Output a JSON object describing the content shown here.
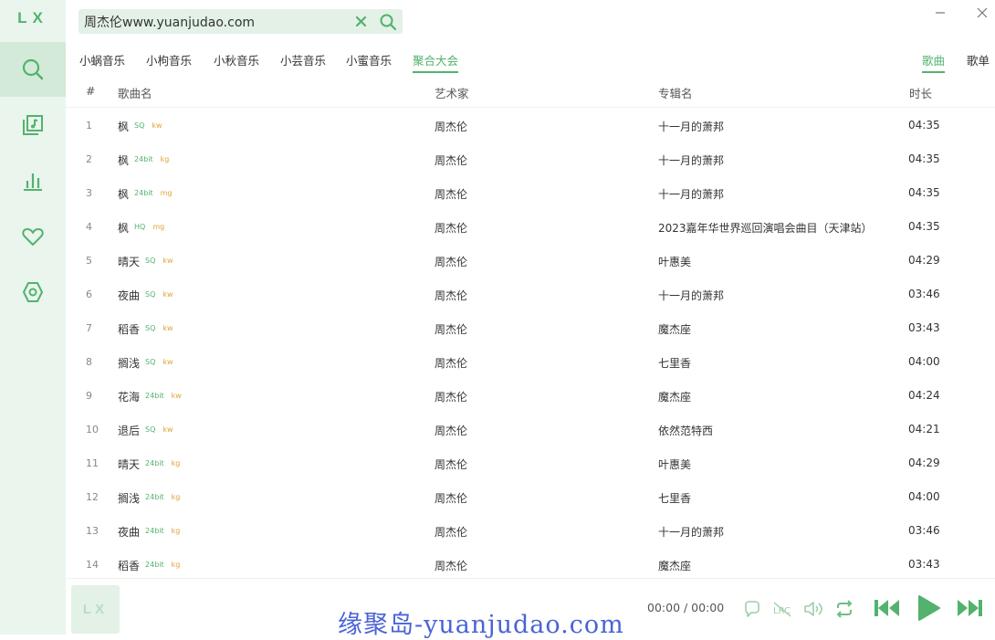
{
  "app": {
    "logo": "LX"
  },
  "sidebar": {
    "items": [
      {
        "name": "search",
        "active": true
      },
      {
        "name": "song-list"
      },
      {
        "name": "leaderboard"
      },
      {
        "name": "my-list"
      },
      {
        "name": "settings"
      }
    ]
  },
  "search": {
    "value": "周杰伦www.yuanjudao.com"
  },
  "sources": [
    "小蜗音乐",
    "小枸音乐",
    "小秋音乐",
    "小芸音乐",
    "小蜜音乐",
    "聚合大会"
  ],
  "active_source": "聚合大会",
  "search_type": {
    "song": "歌曲",
    "playlist": "歌单",
    "active": "歌曲"
  },
  "table": {
    "headers": {
      "num": "#",
      "name": "歌曲名",
      "artist": "艺术家",
      "album": "专辑名",
      "duration": "时长"
    },
    "rows": [
      {
        "num": "1",
        "name": "枫",
        "quality": "SQ",
        "source": "kw",
        "artist": "周杰伦",
        "album": "十一月的萧邦",
        "duration": "04:35"
      },
      {
        "num": "2",
        "name": "枫",
        "quality": "24bit",
        "source": "kg",
        "artist": "周杰伦",
        "album": "十一月的萧邦",
        "duration": "04:35"
      },
      {
        "num": "3",
        "name": "枫",
        "quality": "24bit",
        "source": "mg",
        "artist": "周杰伦",
        "album": "十一月的萧邦",
        "duration": "04:35"
      },
      {
        "num": "4",
        "name": "枫",
        "quality": "HQ",
        "source": "mg",
        "artist": "周杰伦",
        "album": "2023嘉年华世界巡回演唱会曲目（天津站）",
        "duration": "04:35"
      },
      {
        "num": "5",
        "name": "晴天",
        "quality": "SQ",
        "source": "kw",
        "artist": "周杰伦",
        "album": "叶惠美",
        "duration": "04:29"
      },
      {
        "num": "6",
        "name": "夜曲",
        "quality": "SQ",
        "source": "kw",
        "artist": "周杰伦",
        "album": "十一月的萧邦",
        "duration": "03:46"
      },
      {
        "num": "7",
        "name": "稻香",
        "quality": "SQ",
        "source": "kw",
        "artist": "周杰伦",
        "album": "魔杰座",
        "duration": "03:43"
      },
      {
        "num": "8",
        "name": "搁浅",
        "quality": "SQ",
        "source": "kw",
        "artist": "周杰伦",
        "album": "七里香",
        "duration": "04:00"
      },
      {
        "num": "9",
        "name": "花海",
        "quality": "24bit",
        "source": "kw",
        "artist": "周杰伦",
        "album": "魔杰座",
        "duration": "04:24"
      },
      {
        "num": "10",
        "name": "退后",
        "quality": "SQ",
        "source": "kw",
        "artist": "周杰伦",
        "album": "依然范特西",
        "duration": "04:21"
      },
      {
        "num": "11",
        "name": "晴天",
        "quality": "24bit",
        "source": "kg",
        "artist": "周杰伦",
        "album": "叶惠美",
        "duration": "04:29"
      },
      {
        "num": "12",
        "name": "搁浅",
        "quality": "24bit",
        "source": "kg",
        "artist": "周杰伦",
        "album": "七里香",
        "duration": "04:00"
      },
      {
        "num": "13",
        "name": "夜曲",
        "quality": "24bit",
        "source": "kg",
        "artist": "周杰伦",
        "album": "十一月的萧邦",
        "duration": "03:46"
      },
      {
        "num": "14",
        "name": "稻香",
        "quality": "24bit",
        "source": "kg",
        "artist": "周杰伦",
        "album": "魔杰座",
        "duration": "03:43"
      }
    ]
  },
  "player": {
    "cover_text": "LX",
    "time": "00:00 / 00:00"
  },
  "watermark": "缘聚岛-yuanjudao.com",
  "colors": {
    "accent": "#53b26d",
    "sidebar_bg": "#eaf5ee",
    "source_badge": "#e0a33a",
    "watermark": "#4a63d6"
  }
}
